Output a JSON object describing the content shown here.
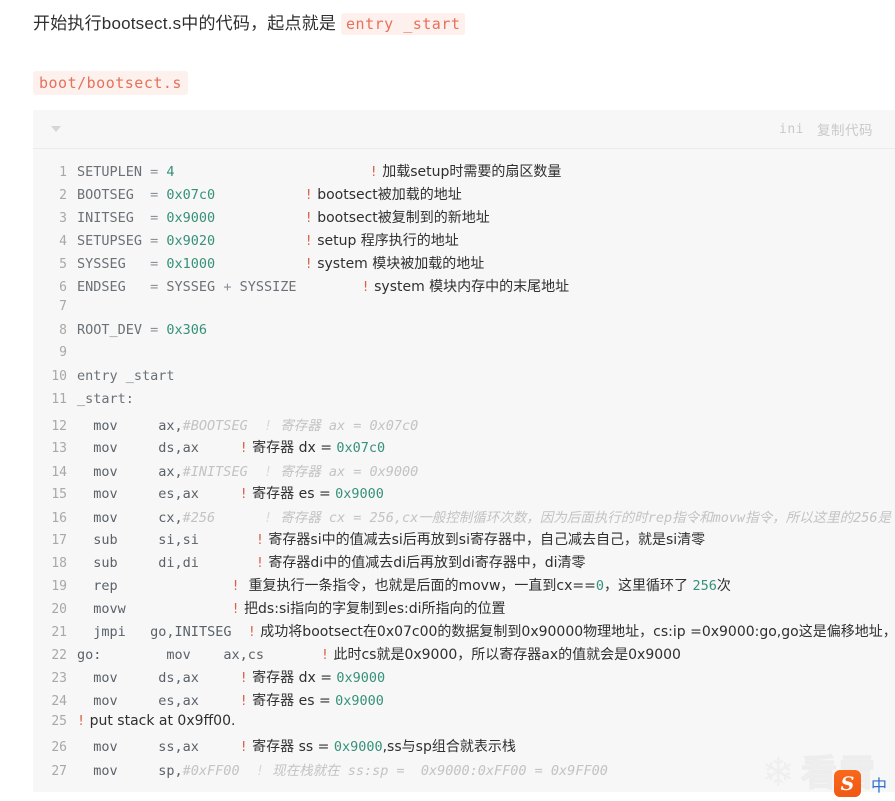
{
  "intro": {
    "text_before": "开始执行bootsect.s中的代码，起点就是 ",
    "inline_code": "entry _start"
  },
  "path": {
    "code": "boot/bootsect.s"
  },
  "codeblock": {
    "language_label": "ini",
    "copy_label": "复制代码",
    "caret_icon": "chevron-down-icon",
    "lines": [
      {
        "num": "1",
        "tokens": [
          {
            "t": "id",
            "v": "SETUPLEN "
          },
          {
            "t": "punc",
            "v": "= "
          },
          {
            "t": "val",
            "v": "4"
          },
          {
            "t": "sp",
            "v": "                        "
          },
          {
            "t": "bang",
            "v": "!"
          },
          {
            "t": "cmt",
            "v": " 加载setup时需要的扇区数量"
          }
        ]
      },
      {
        "num": "2",
        "tokens": [
          {
            "t": "id",
            "v": "BOOTSEG  "
          },
          {
            "t": "punc",
            "v": "= "
          },
          {
            "t": "val",
            "v": "0x07c0"
          },
          {
            "t": "sp",
            "v": "           "
          },
          {
            "t": "bang",
            "v": "!"
          },
          {
            "t": "cmt",
            "v": " bootsect被加载的地址"
          }
        ]
      },
      {
        "num": "3",
        "tokens": [
          {
            "t": "id",
            "v": "INITSEG  "
          },
          {
            "t": "punc",
            "v": "= "
          },
          {
            "t": "val",
            "v": "0x9000"
          },
          {
            "t": "sp",
            "v": "           "
          },
          {
            "t": "bang",
            "v": "!"
          },
          {
            "t": "cmt",
            "v": " bootsect被复制到的新地址"
          }
        ]
      },
      {
        "num": "4",
        "tokens": [
          {
            "t": "id",
            "v": "SETUPSEG "
          },
          {
            "t": "punc",
            "v": "= "
          },
          {
            "t": "val",
            "v": "0x9020"
          },
          {
            "t": "sp",
            "v": "           "
          },
          {
            "t": "bang",
            "v": "!"
          },
          {
            "t": "cmt",
            "v": " setup 程序执行的地址"
          }
        ]
      },
      {
        "num": "5",
        "tokens": [
          {
            "t": "id",
            "v": "SYSSEG   "
          },
          {
            "t": "punc",
            "v": "= "
          },
          {
            "t": "val",
            "v": "0x1000"
          },
          {
            "t": "sp",
            "v": "           "
          },
          {
            "t": "bang",
            "v": "!"
          },
          {
            "t": "cmt",
            "v": " system 模块被加载的地址"
          }
        ]
      },
      {
        "num": "6",
        "tokens": [
          {
            "t": "id",
            "v": "ENDSEG   "
          },
          {
            "t": "punc",
            "v": "= "
          },
          {
            "t": "id",
            "v": "SYSSEG "
          },
          {
            "t": "punc",
            "v": "+ "
          },
          {
            "t": "id",
            "v": "SYSSIZE"
          },
          {
            "t": "sp",
            "v": "        "
          },
          {
            "t": "bang",
            "v": "!"
          },
          {
            "t": "cmt",
            "v": " system 模块内存中的末尾地址"
          }
        ]
      },
      {
        "num": "7",
        "tokens": []
      },
      {
        "num": "8",
        "tokens": [
          {
            "t": "id",
            "v": "ROOT_DEV "
          },
          {
            "t": "punc",
            "v": "= "
          },
          {
            "t": "val",
            "v": "0x306"
          }
        ]
      },
      {
        "num": "9",
        "tokens": []
      },
      {
        "num": "10",
        "tokens": [
          {
            "t": "id",
            "v": "entry _start"
          }
        ]
      },
      {
        "num": "11",
        "tokens": [
          {
            "t": "id",
            "v": "_start:"
          }
        ]
      },
      {
        "num": "12",
        "tokens": [
          {
            "t": "key",
            "v": "  mov"
          },
          {
            "t": "sp",
            "v": "     "
          },
          {
            "t": "key",
            "v": "ax,"
          },
          {
            "t": "gray",
            "v": "#BOOTSEG"
          },
          {
            "t": "sp",
            "v": "  "
          },
          {
            "t": "gray-bang",
            "v": "!"
          },
          {
            "t": "gray",
            "v": " 寄存器 ax = 0x07c0"
          }
        ]
      },
      {
        "num": "13",
        "tokens": [
          {
            "t": "key",
            "v": "  mov"
          },
          {
            "t": "sp",
            "v": "     "
          },
          {
            "t": "key",
            "v": "ds,ax"
          },
          {
            "t": "sp",
            "v": "     "
          },
          {
            "t": "bang",
            "v": "!"
          },
          {
            "t": "cmt",
            "v": " 寄存器 dx = "
          },
          {
            "t": "cmt-num",
            "v": "0x07c0"
          }
        ]
      },
      {
        "num": "14",
        "tokens": [
          {
            "t": "key",
            "v": "  mov"
          },
          {
            "t": "sp",
            "v": "     "
          },
          {
            "t": "key",
            "v": "ax,"
          },
          {
            "t": "gray",
            "v": "#INITSEG"
          },
          {
            "t": "sp",
            "v": "  "
          },
          {
            "t": "gray-bang",
            "v": "!"
          },
          {
            "t": "gray",
            "v": " 寄存器 ax = 0x9000"
          }
        ]
      },
      {
        "num": "15",
        "tokens": [
          {
            "t": "key",
            "v": "  mov"
          },
          {
            "t": "sp",
            "v": "     "
          },
          {
            "t": "key",
            "v": "es,ax"
          },
          {
            "t": "sp",
            "v": "     "
          },
          {
            "t": "bang",
            "v": "!"
          },
          {
            "t": "cmt",
            "v": " 寄存器 es = "
          },
          {
            "t": "cmt-num",
            "v": "0x9000"
          }
        ]
      },
      {
        "num": "16",
        "tokens": [
          {
            "t": "key",
            "v": "  mov"
          },
          {
            "t": "sp",
            "v": "     "
          },
          {
            "t": "key",
            "v": "cx,"
          },
          {
            "t": "gray",
            "v": "#256"
          },
          {
            "t": "sp",
            "v": "      "
          },
          {
            "t": "gray-bang",
            "v": "!"
          },
          {
            "t": "gray",
            "v": " 寄存器 cx = 256,cx一般控制循环次数，因为后面执行的时rep指令和movw指令，所以这里的256是"
          }
        ]
      },
      {
        "num": "17",
        "tokens": [
          {
            "t": "key",
            "v": "  sub"
          },
          {
            "t": "sp",
            "v": "     "
          },
          {
            "t": "key",
            "v": "si,si"
          },
          {
            "t": "sp",
            "v": "       "
          },
          {
            "t": "bang",
            "v": "!"
          },
          {
            "t": "cmt",
            "v": " 寄存器si中的值减去si后再放到si寄存器中，自己减去自己，就是si清零"
          }
        ]
      },
      {
        "num": "18",
        "tokens": [
          {
            "t": "key",
            "v": "  sub"
          },
          {
            "t": "sp",
            "v": "     "
          },
          {
            "t": "key",
            "v": "di,di"
          },
          {
            "t": "sp",
            "v": "       "
          },
          {
            "t": "bang",
            "v": "!"
          },
          {
            "t": "cmt",
            "v": " 寄存器di中的值减去di后再放到di寄存器中，di清零"
          }
        ]
      },
      {
        "num": "19",
        "tokens": [
          {
            "t": "key",
            "v": "  rep"
          },
          {
            "t": "sp",
            "v": "              "
          },
          {
            "t": "bang",
            "v": "!"
          },
          {
            "t": "cmt",
            "v": "  重复执行一条指令，也就是后面的movw，一直到cx=="
          },
          {
            "t": "cmt-num",
            "v": "0"
          },
          {
            "t": "cmt",
            "v": "，这里循环了 "
          },
          {
            "t": "cmt-num",
            "v": "256"
          },
          {
            "t": "cmt",
            "v": "次"
          }
        ]
      },
      {
        "num": "20",
        "tokens": [
          {
            "t": "key",
            "v": "  movw"
          },
          {
            "t": "sp",
            "v": "             "
          },
          {
            "t": "bang",
            "v": "!"
          },
          {
            "t": "cmt",
            "v": " 把ds:si指向的字复制到es:di所指向的位置"
          }
        ]
      },
      {
        "num": "21",
        "tokens": [
          {
            "t": "key",
            "v": "  jmpi"
          },
          {
            "t": "sp",
            "v": "   "
          },
          {
            "t": "key",
            "v": "go,INITSEG"
          },
          {
            "t": "sp",
            "v": "  "
          },
          {
            "t": "bang",
            "v": "!"
          },
          {
            "t": "cmt",
            "v": " 成功将bootsect在0x07c00的数据复制到0x90000物理地址，cs:ip =0x9000:go,go这是偏移地址，"
          }
        ]
      },
      {
        "num": "22",
        "tokens": [
          {
            "t": "key",
            "v": "go:"
          },
          {
            "t": "sp",
            "v": "        "
          },
          {
            "t": "key",
            "v": "mov"
          },
          {
            "t": "sp",
            "v": "    "
          },
          {
            "t": "key",
            "v": "ax,cs"
          },
          {
            "t": "sp",
            "v": "       "
          },
          {
            "t": "bang",
            "v": "!"
          },
          {
            "t": "cmt",
            "v": " 此时cs就是0x9000，所以寄存器ax的值就会是0x9000"
          }
        ]
      },
      {
        "num": "23",
        "tokens": [
          {
            "t": "key",
            "v": "  mov"
          },
          {
            "t": "sp",
            "v": "     "
          },
          {
            "t": "key",
            "v": "ds,ax"
          },
          {
            "t": "sp",
            "v": "     "
          },
          {
            "t": "bang",
            "v": "!"
          },
          {
            "t": "cmt",
            "v": " 寄存器 dx = "
          },
          {
            "t": "cmt-num",
            "v": "0x9000"
          }
        ]
      },
      {
        "num": "24",
        "tokens": [
          {
            "t": "key",
            "v": "  mov"
          },
          {
            "t": "sp",
            "v": "     "
          },
          {
            "t": "key",
            "v": "es,ax"
          },
          {
            "t": "sp",
            "v": "     "
          },
          {
            "t": "bang",
            "v": "!"
          },
          {
            "t": "cmt",
            "v": " 寄存器 es = "
          },
          {
            "t": "cmt-num",
            "v": "0x9000"
          }
        ]
      },
      {
        "num": "25",
        "tokens": [
          {
            "t": "bang",
            "v": "!"
          },
          {
            "t": "cmt",
            "v": " put stack at 0x9ff00."
          }
        ]
      },
      {
        "num": "26",
        "tokens": [
          {
            "t": "key",
            "v": "  mov"
          },
          {
            "t": "sp",
            "v": "     "
          },
          {
            "t": "key",
            "v": "ss,ax"
          },
          {
            "t": "sp",
            "v": "     "
          },
          {
            "t": "bang",
            "v": "!"
          },
          {
            "t": "cmt",
            "v": " 寄存器 ss = "
          },
          {
            "t": "cmt-num",
            "v": "0x9000"
          },
          {
            "t": "cmt",
            "v": ",ss与sp组合就表示栈"
          }
        ]
      },
      {
        "num": "27",
        "tokens": [
          {
            "t": "key",
            "v": "  mov"
          },
          {
            "t": "sp",
            "v": "     "
          },
          {
            "t": "key",
            "v": "sp,"
          },
          {
            "t": "gray",
            "v": "#0xFF00"
          },
          {
            "t": "sp",
            "v": "  "
          },
          {
            "t": "gray-bang",
            "v": "!"
          },
          {
            "t": "gray",
            "v": " 现在栈就在 ss:sp =  0x9000:0xFF00 = 0x9FF00"
          }
        ]
      }
    ]
  },
  "watermark": {
    "icon": "snowflake-icon",
    "text": "看雪"
  },
  "ime": {
    "logo_text": "S",
    "mode_label": "中"
  },
  "colors": {
    "inline_code_text": "#e8705a",
    "inline_code_bg": "#fdf0ed",
    "code_value": "#36917a",
    "code_identifier": "#6b7177",
    "comment_bang": "#d8634a",
    "codeblock_bg": "#f7f7f7",
    "ime_accent": "#ef5715"
  }
}
